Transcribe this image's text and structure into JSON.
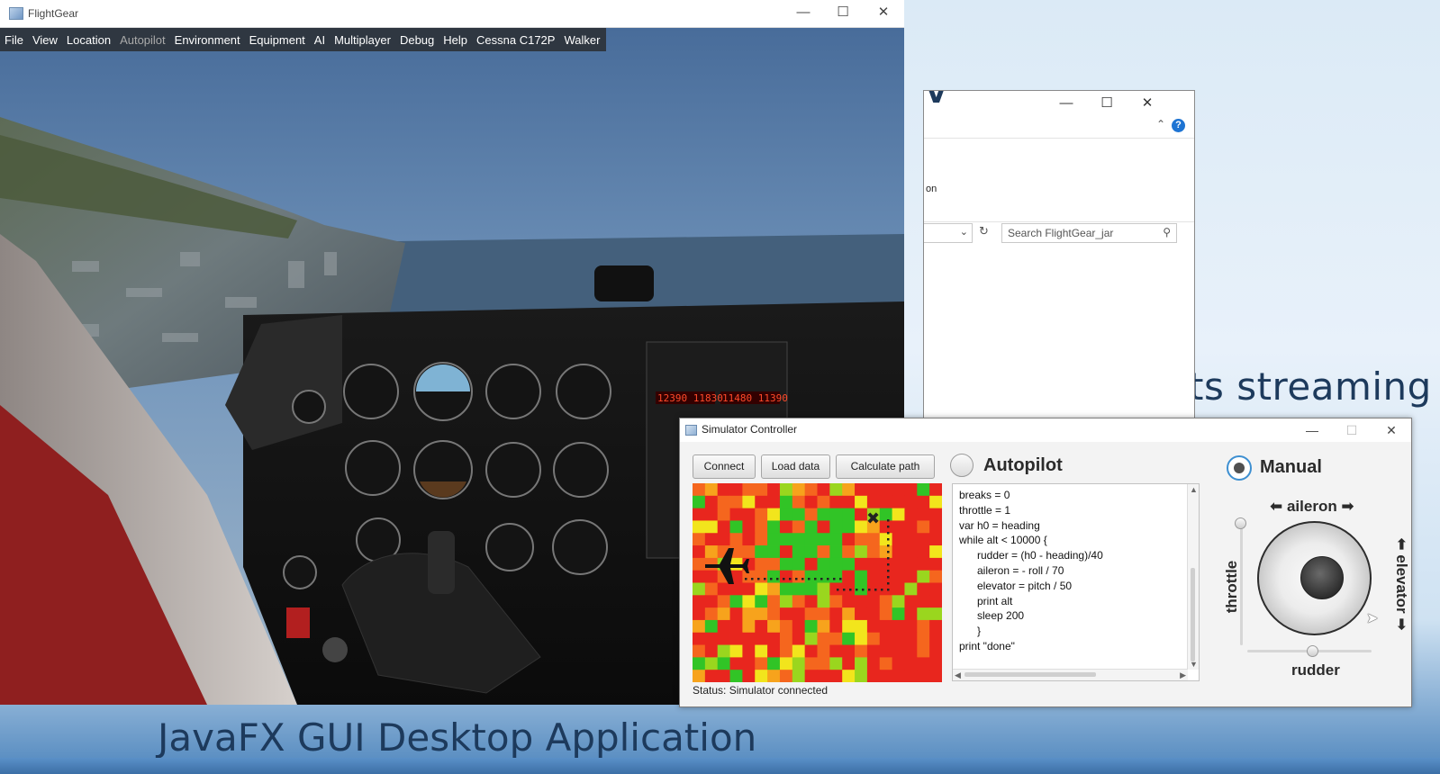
{
  "desktop": {
    "slide_text_streaming": "ts streaming",
    "slide_title": "JavaFX GUI Desktop Application"
  },
  "explorer": {
    "ribbon_text": "on",
    "search_placeholder": "Search FlightGear_jar",
    "minimize_icon": "minimize-icon",
    "maximize_icon": "maximize-icon",
    "close_icon": "close-icon",
    "help_icon": "?"
  },
  "flightgear": {
    "title": "FlightGear",
    "menu": [
      "File",
      "View",
      "Location",
      "Autopilot",
      "Environment",
      "Equipment",
      "AI",
      "Multiplayer",
      "Debug",
      "Help",
      "Cessna C172P",
      "Walker"
    ],
    "disabled_menu": "Autopilot"
  },
  "sim": {
    "title": "Simulator Controller",
    "buttons": {
      "connect": "Connect",
      "load_data": "Load data",
      "calculate_path": "Calculate path"
    },
    "autopilot_label": "Autopilot",
    "manual_label": "Manual",
    "mode_selected": "manual",
    "status": "Status: Simulator connected",
    "code": "breaks = 0\nthrottle = 1\nvar h0 = heading\nwhile alt < 10000 {\n      rudder = (h0 - heading)/40\n      aileron = - roll / 70\n      elevator = pitch / 50\n      print alt\n      sleep 200\n      }\nprint \"done\"",
    "joystick": {
      "aileron_label": "⬅ aileron ➡",
      "elevator_label": "⬅ elevator ➡",
      "throttle_label": "throttle",
      "rudder_label": "rudder",
      "throttle_value": 1.0,
      "rudder_value": 0.5,
      "aileron_value": 0.5,
      "elevator_value": 0.5
    },
    "heatmap": {
      "rows": 16,
      "cols": 20,
      "colors": {
        "red": "#e8261e",
        "orange": "#f5661e",
        "amber": "#f7a31c",
        "yellow": "#f2e51c",
        "lightgreen": "#9ad61e",
        "green": "#31c426"
      },
      "plane_icon": "airplane-icon",
      "target_icon": "x-target-icon"
    }
  }
}
